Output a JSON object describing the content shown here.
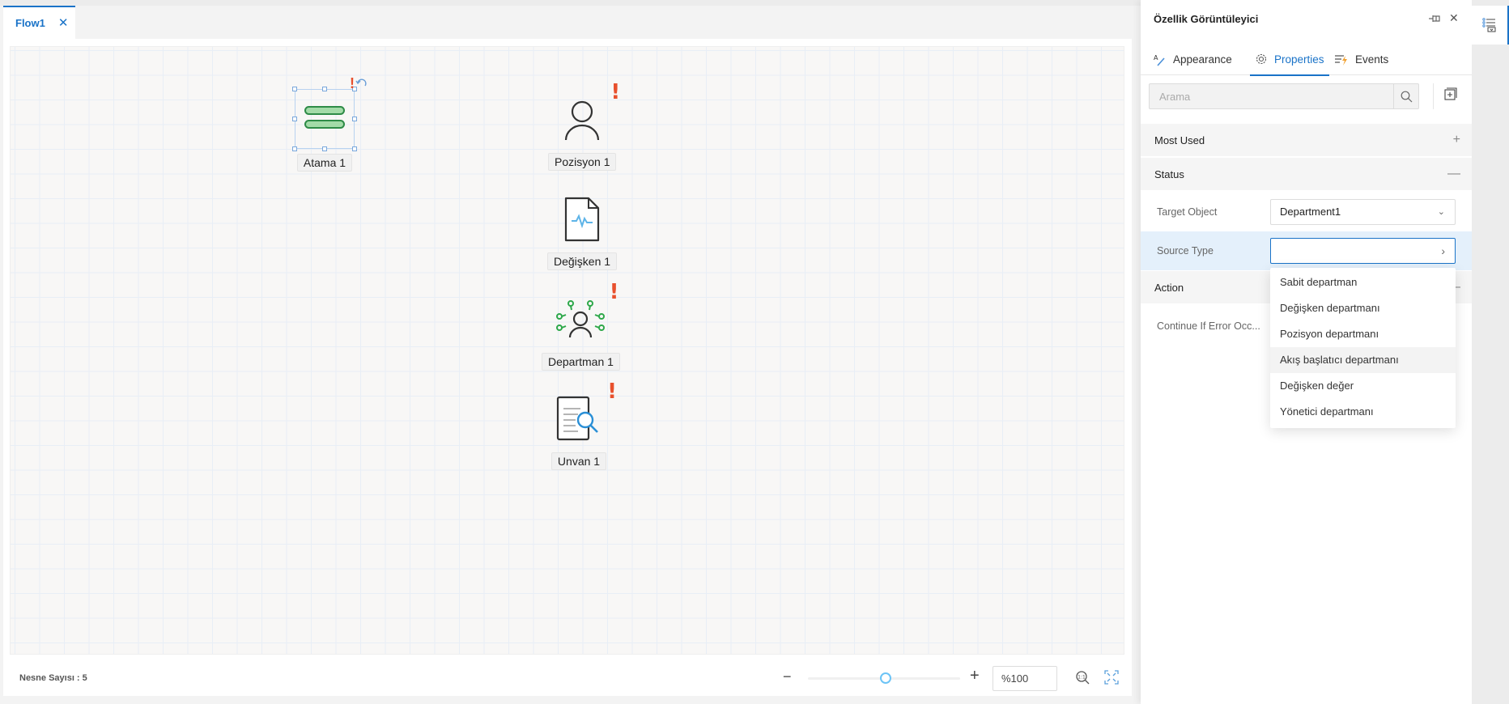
{
  "editor": {
    "tab": {
      "label": "Flow1",
      "close_icon": "close-icon"
    },
    "nodes": [
      {
        "id": "atama",
        "label": "Atama 1",
        "icon": "assignment-icon",
        "selected": true,
        "warning": true
      },
      {
        "id": "pozisyon",
        "label": "Pozisyon 1",
        "icon": "person-icon",
        "selected": false,
        "warning": true
      },
      {
        "id": "degisken",
        "label": "Değişken 1",
        "icon": "variable-document-icon",
        "selected": false,
        "warning": false
      },
      {
        "id": "departman",
        "label": "Departman 1",
        "icon": "department-icon",
        "selected": false,
        "warning": true
      },
      {
        "id": "unvan",
        "label": "Unvan 1",
        "icon": "title-search-document-icon",
        "selected": false,
        "warning": true
      }
    ],
    "warning_glyph": "!",
    "status": {
      "object_count": "Nesne Sayısı : 5"
    },
    "zoom": {
      "minus": "−",
      "plus": "+",
      "value": "%100",
      "slider_percent": 50
    }
  },
  "panel": {
    "title": "Özellik Görüntüleyici",
    "tabs": [
      {
        "label": "Appearance",
        "icon": "appearance-icon",
        "active": false
      },
      {
        "label": "Properties",
        "icon": "gear-icon",
        "active": true
      },
      {
        "label": "Events",
        "icon": "events-icon",
        "active": false
      }
    ],
    "search": {
      "placeholder": "Arama"
    },
    "sections": [
      {
        "label": "Most Used",
        "toggle": "+"
      },
      {
        "label": "Status",
        "toggle": "—"
      },
      {
        "label": "Action",
        "toggle": "—"
      }
    ],
    "fields": {
      "target_object": {
        "label": "Target Object",
        "value": "Department1"
      },
      "source_type": {
        "label": "Source Type",
        "value": ""
      },
      "continue_if_error": {
        "label": "Continue If Error Occ..."
      }
    },
    "source_type_options": [
      "Sabit departman",
      "Değişken departmanı",
      "Pozisyon departmanı",
      "Akış başlatıcı departmanı",
      "Değişken değer",
      "Yönetici departmanı"
    ],
    "hovered_option_index": 3
  },
  "colors": {
    "accent": "#1a73c8",
    "warning": "#e8502d",
    "node_green": "#2e8b47",
    "node_blue": "#4aa3df"
  }
}
